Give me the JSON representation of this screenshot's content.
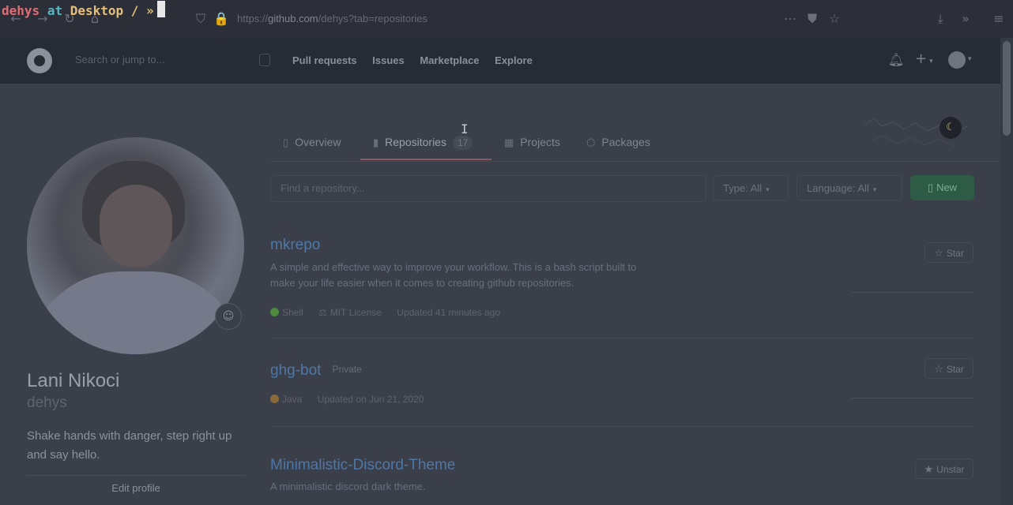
{
  "terminal": {
    "user": "dehys",
    "at": "at",
    "dir": "Desktop",
    "sep": "/",
    "prompt": "»"
  },
  "browser": {
    "url_prefix": "https://",
    "url_host": "github.com",
    "url_path": "/dehys?tab=repositories"
  },
  "header": {
    "search_placeholder": "Search or jump to...",
    "nav": [
      "Pull requests",
      "Issues",
      "Marketplace",
      "Explore"
    ]
  },
  "profile": {
    "name": "Lani Nikoci",
    "login": "dehys",
    "bio": "Shake hands with danger, step right up and say hello.",
    "edit_label": "Edit profile"
  },
  "tabs": {
    "overview": "Overview",
    "repositories": "Repositories",
    "repositories_count": "17",
    "projects": "Projects",
    "packages": "Packages"
  },
  "filters": {
    "find_placeholder": "Find a repository...",
    "type_label": "Type: All",
    "language_label": "Language: All",
    "new_label": "New"
  },
  "repos": [
    {
      "name": "mkrepo",
      "private_label": "",
      "description": "A simple and effective way to improve your workflow. This is a bash script built to make your life easier when it comes to creating github repositories.",
      "language": "Shell",
      "language_color": "#4f8a3c",
      "license": "MIT License",
      "updated": "Updated 41 minutes ago",
      "star_label": "Star"
    },
    {
      "name": "ghg-bot",
      "private_label": "Private",
      "description": "",
      "language": "Java",
      "language_color": "#8a6a3a",
      "license": "",
      "updated": "Updated on Jun 21, 2020",
      "star_label": "Star"
    },
    {
      "name": "Minimalistic-Discord-Theme",
      "private_label": "",
      "description": "A minimalistic discord dark theme.",
      "language": "",
      "language_color": "",
      "license": "",
      "updated": "",
      "star_label": "Unstar"
    }
  ],
  "colors": {
    "page_bg": "#3b3f4a",
    "header_bg": "#272b33",
    "link": "#4e77a6",
    "tab_accent": "#8a5a64",
    "new_button": "#2d5b45"
  }
}
